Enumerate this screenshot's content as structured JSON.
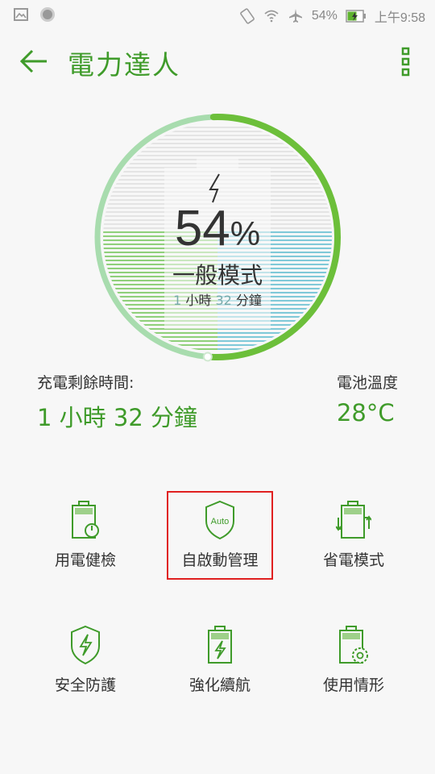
{
  "status_bar": {
    "battery_percent": "54%",
    "time": "上午9:58"
  },
  "app_bar": {
    "title": "電力達人"
  },
  "gauge": {
    "percent_value": "54",
    "percent_sign": "%",
    "mode": "一般模式",
    "remaining": {
      "h": "1",
      "h_unit": "小時",
      "m": "32",
      "m_unit": "分鐘"
    },
    "level": 0.54
  },
  "info": {
    "charge_label": "充電剩餘時間:",
    "charge_value": "1 小時 32 分鐘",
    "temp_label": "電池溫度",
    "temp_value": "28°C"
  },
  "tiles": [
    {
      "label": "用電健檢",
      "icon": "battery-check-icon"
    },
    {
      "label": "自啟動管理",
      "icon": "auto-shield-icon",
      "badge": "Auto"
    },
    {
      "label": "省電模式",
      "icon": "battery-swap-icon"
    },
    {
      "label": "安全防護",
      "icon": "security-shield-icon"
    },
    {
      "label": "強化續航",
      "icon": "battery-bolt-icon"
    },
    {
      "label": "使用情形",
      "icon": "battery-gear-icon"
    }
  ],
  "colors": {
    "accent": "#3f9b2a",
    "ring_light": "#a8dcae",
    "ring_dark": "#6cbf3a"
  }
}
